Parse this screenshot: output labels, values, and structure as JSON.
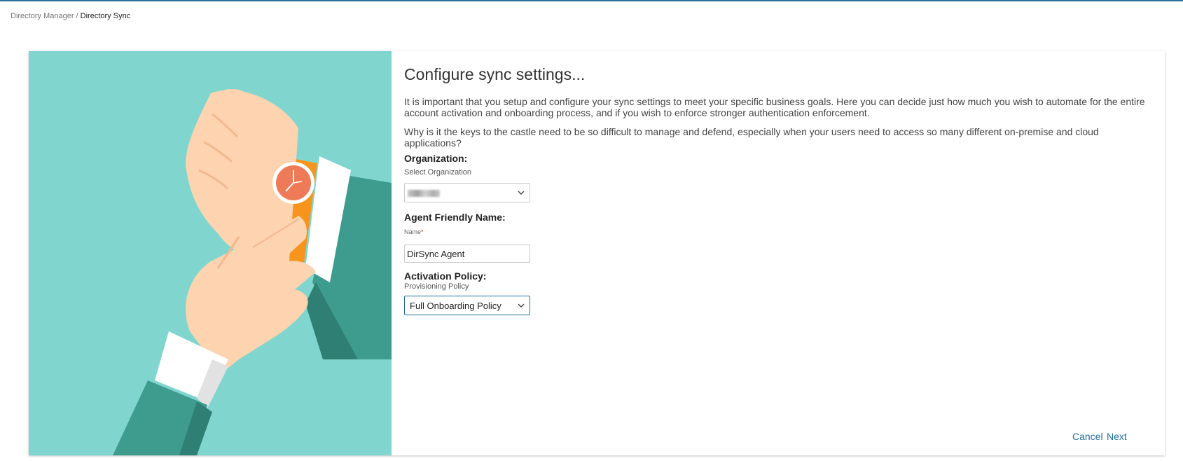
{
  "breadcrumb": {
    "parent": "Directory Manager",
    "separator": "/",
    "current": "Directory Sync"
  },
  "colors": {
    "accent": "#1e6ea0",
    "hero_background": "#80d6ce"
  },
  "main": {
    "title": "Configure sync settings...",
    "paragraph1": "It is important that you setup and configure your sync settings to meet your specific business goals. Here you can decide just how much you wish to automate for the entire account activation and onboarding process, and if you wish to enforce stronger authentication enforcement.",
    "paragraph2": "Why is it the keys to the castle need to be so difficult to manage and defend, especially when your users need to access so many different on-premise and cloud applications?",
    "organization": {
      "label": "Organization:",
      "sub_label": "Select Organization",
      "selected_value_blurred": true
    },
    "agent": {
      "label": "Agent Friendly Name:",
      "field_label": "Name",
      "required_mark": "*",
      "value": "DirSync Agent"
    },
    "activation": {
      "label": "Activation Policy:",
      "sub_label": "Provisioning Policy",
      "selected_value": "Full Onboarding Policy"
    },
    "actions": {
      "cancel": "Cancel",
      "next": "Next"
    }
  },
  "icons": {
    "dropdown": "chevron-down-icon",
    "illustration": "wristwatch-illustration"
  }
}
